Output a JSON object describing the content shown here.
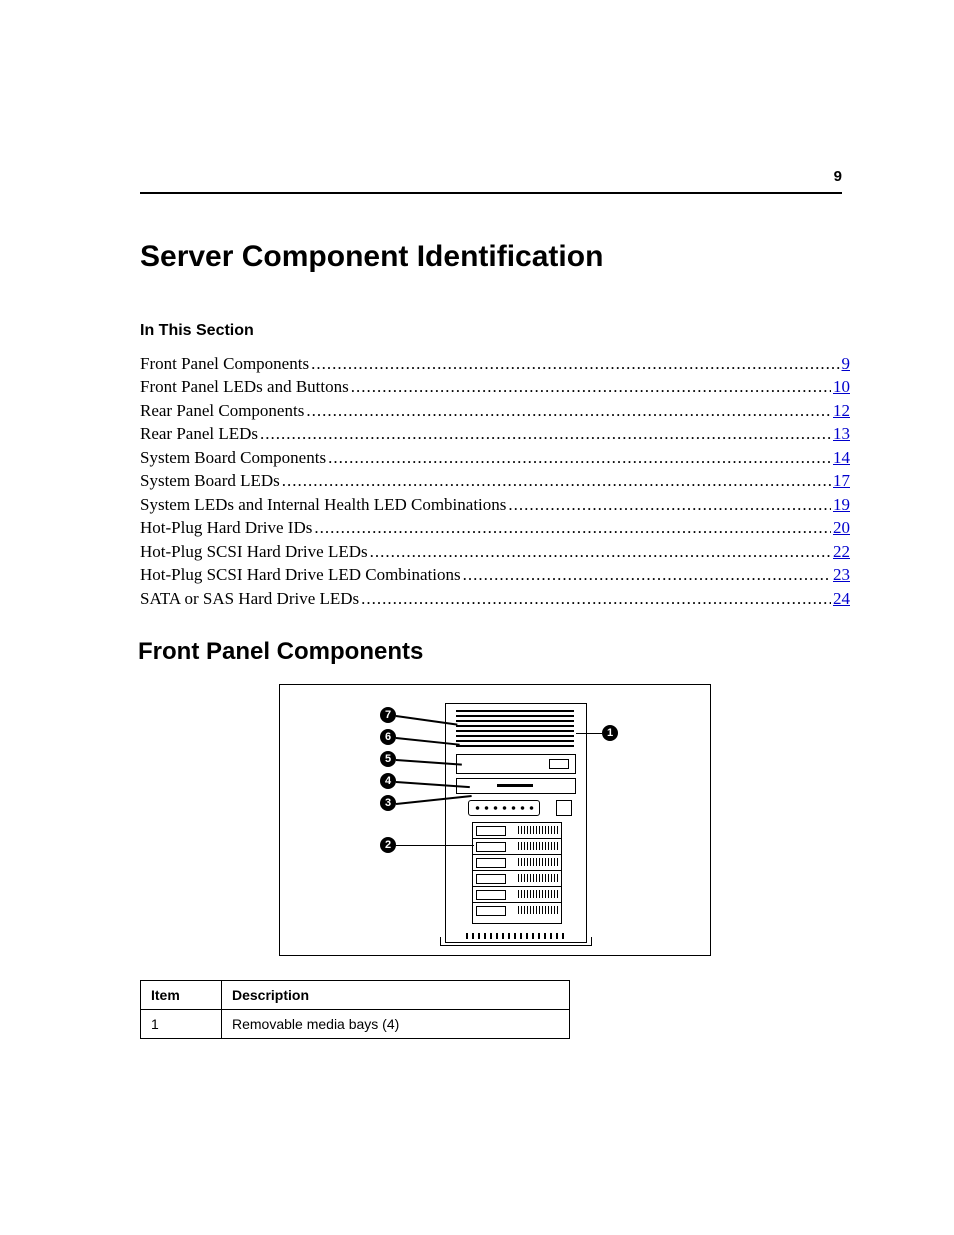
{
  "page_number": "9",
  "title": "Server Component Identification",
  "section_label": "In This Section",
  "toc": [
    {
      "label": "Front Panel Components",
      "page": "9"
    },
    {
      "label": "Front Panel LEDs and Buttons",
      "page": "10"
    },
    {
      "label": "Rear Panel Components",
      "page": "12"
    },
    {
      "label": "Rear Panel LEDs",
      "page": "13"
    },
    {
      "label": "System Board Components",
      "page": "14"
    },
    {
      "label": "System Board LEDs",
      "page": "17"
    },
    {
      "label": "System LEDs and Internal Health LED Combinations",
      "page": "19"
    },
    {
      "label": "Hot-Plug Hard Drive IDs",
      "page": "20"
    },
    {
      "label": "Hot-Plug SCSI Hard Drive LEDs",
      "page": "22"
    },
    {
      "label": "Hot-Plug SCSI Hard Drive LED Combinations",
      "page": "23"
    },
    {
      "label": "SATA or SAS Hard Drive LEDs",
      "page": "24"
    }
  ],
  "subheading": "Front Panel Components",
  "callouts": [
    "1",
    "2",
    "3",
    "4",
    "5",
    "6",
    "7"
  ],
  "table": {
    "headers": {
      "item": "Item",
      "desc": "Description"
    },
    "rows": [
      {
        "item": "1",
        "desc": "Removable media bays (4)"
      }
    ]
  }
}
